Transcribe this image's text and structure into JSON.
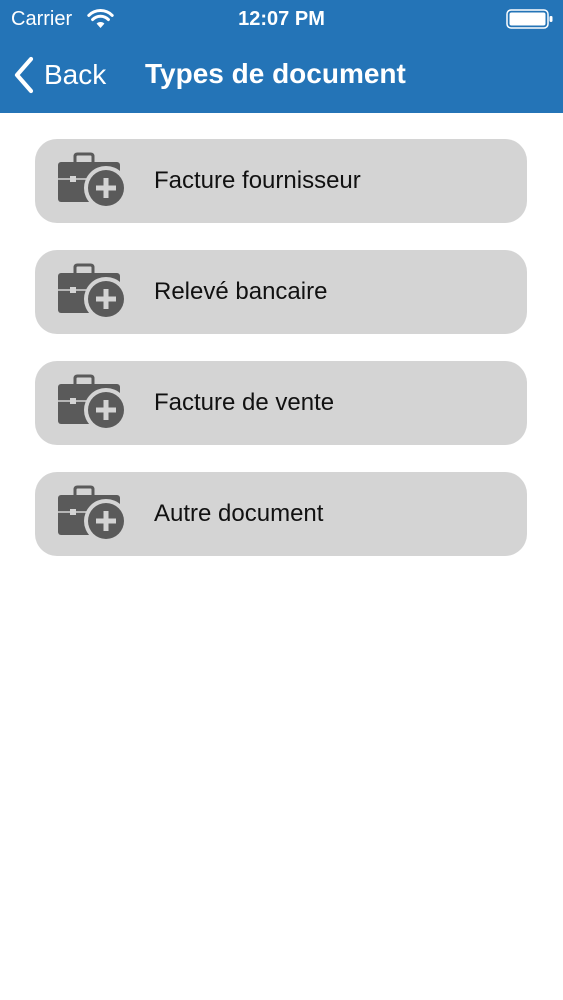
{
  "status_bar": {
    "carrier": "Carrier",
    "time": "12:07 PM",
    "wifi_icon": "wifi-icon",
    "battery_icon": "battery-icon"
  },
  "nav": {
    "back_label": "Back",
    "back_icon": "chevron-left-icon",
    "title": "Types de document"
  },
  "colors": {
    "header_bg": "#2474b7",
    "item_bg": "#d4d4d4",
    "icon_fill": "#5a5a5a"
  },
  "document_types": [
    {
      "label": "Facture fournisseur",
      "icon": "briefcase-add-icon"
    },
    {
      "label": "Relevé bancaire",
      "icon": "briefcase-add-icon"
    },
    {
      "label": "Facture de vente",
      "icon": "briefcase-add-icon"
    },
    {
      "label": "Autre document",
      "icon": "briefcase-add-icon"
    }
  ]
}
